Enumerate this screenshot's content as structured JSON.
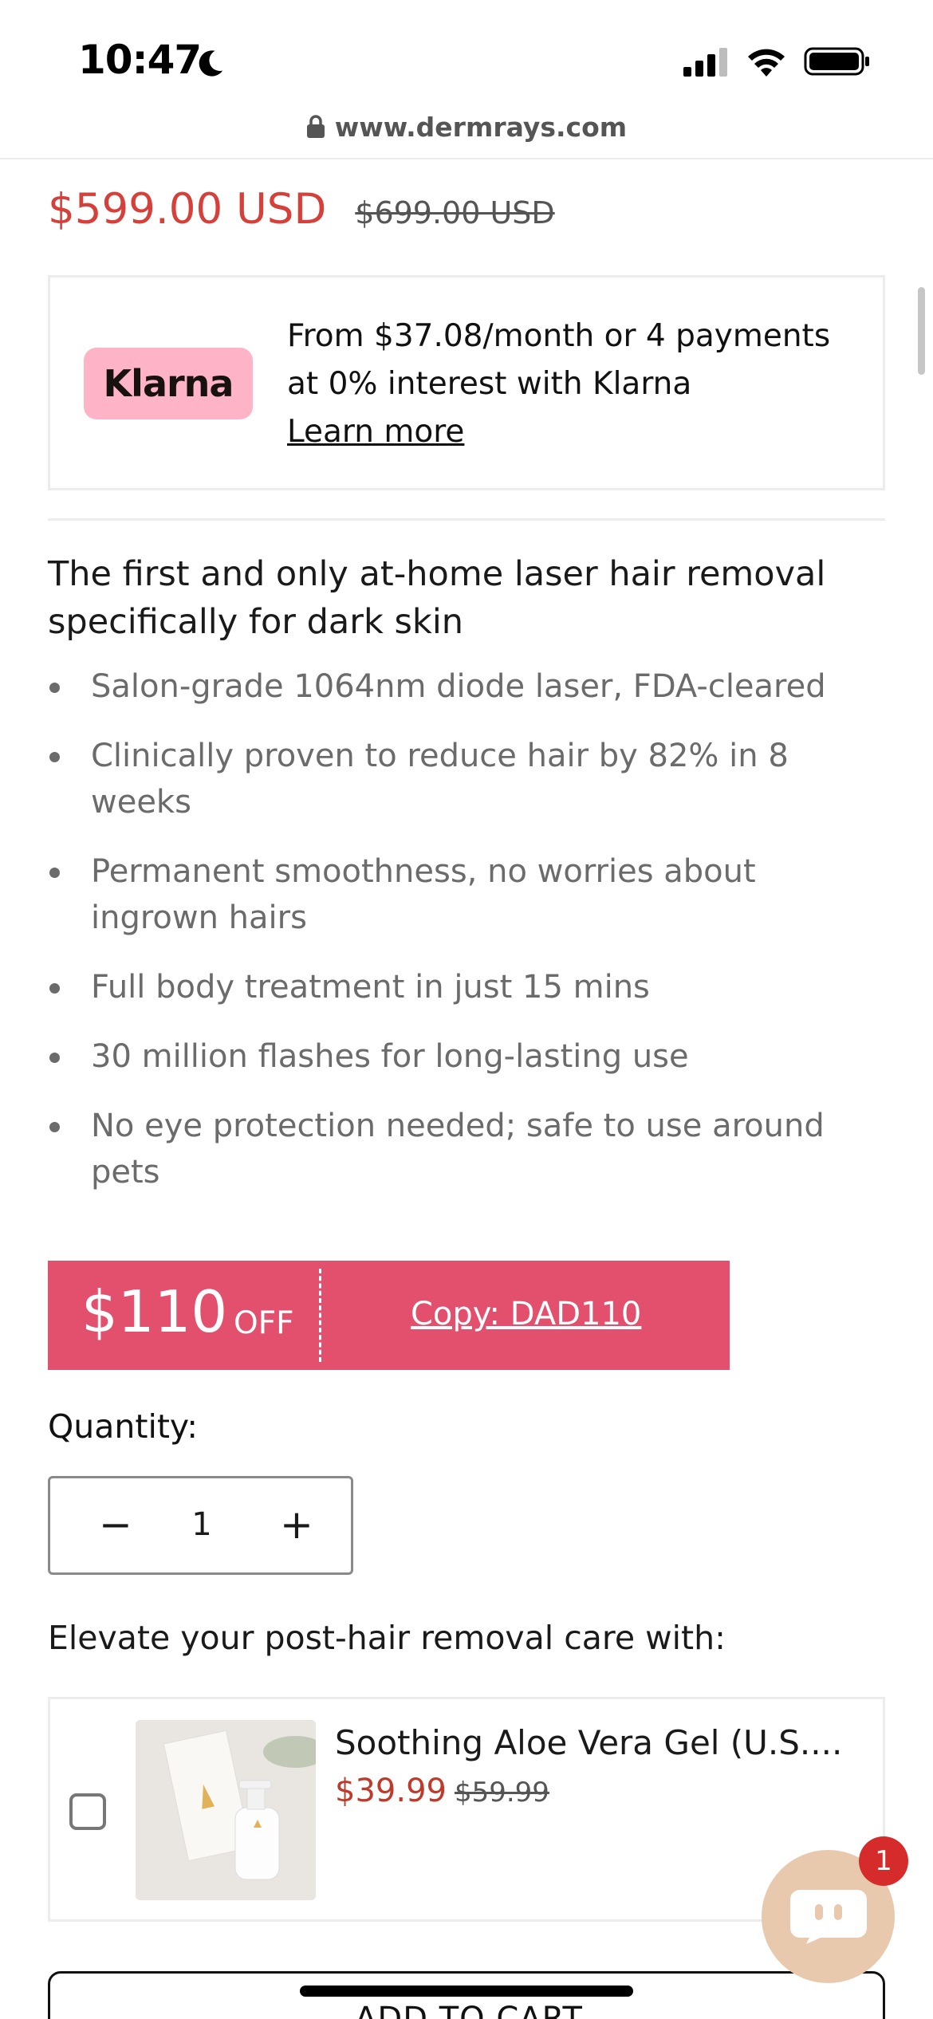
{
  "status_bar": {
    "time": "10:47",
    "icons": [
      "moon-icon",
      "cellular-signal-icon",
      "wifi-icon",
      "battery-icon"
    ]
  },
  "browser": {
    "url": "www.dermrays.com",
    "icon": "lock-icon"
  },
  "product": {
    "price": "$599.00 USD",
    "compare_price": "$699.00 USD",
    "headline": "The first and only at-home laser hair removal specifically for dark skin",
    "features": [
      "Salon-grade 1064nm diode laser, FDA-cleared",
      "Clinically proven to reduce hair by 82% in 8 weeks",
      "Permanent smoothness, no worries about ingrown hairs",
      "Full body treatment in just 15 mins",
      "30 million flashes for long-lasting use",
      "No eye protection needed; safe to use around pets"
    ]
  },
  "klarna": {
    "logo_text": "Klarna",
    "line1": "From $37.08/month or 4 payments",
    "line2": "at 0% interest with Klarna",
    "link": "Learn more"
  },
  "coupon": {
    "amount": "$110",
    "off": "OFF",
    "copy_label": "Copy: DAD110"
  },
  "quantity": {
    "label": "Quantity:",
    "value": "1",
    "minus": "−",
    "plus": "+"
  },
  "upsell": {
    "heading": "Elevate your post-hair removal care with:",
    "item": {
      "title": "Soothing Aloe Vera Gel (U.S....",
      "price": "$39.99",
      "compare_price": "$59.99",
      "checked": false
    }
  },
  "cart": {
    "label": "ADD TO CART"
  },
  "chat": {
    "badge_count": "1",
    "icon": "chat-icon"
  },
  "colors": {
    "price_red": "#d6403a",
    "coupon_pink": "#e3506e",
    "klarna_pink": "#ffb3c7",
    "chat_tan": "#e8c9ad",
    "badge_red": "#d62b2b"
  }
}
